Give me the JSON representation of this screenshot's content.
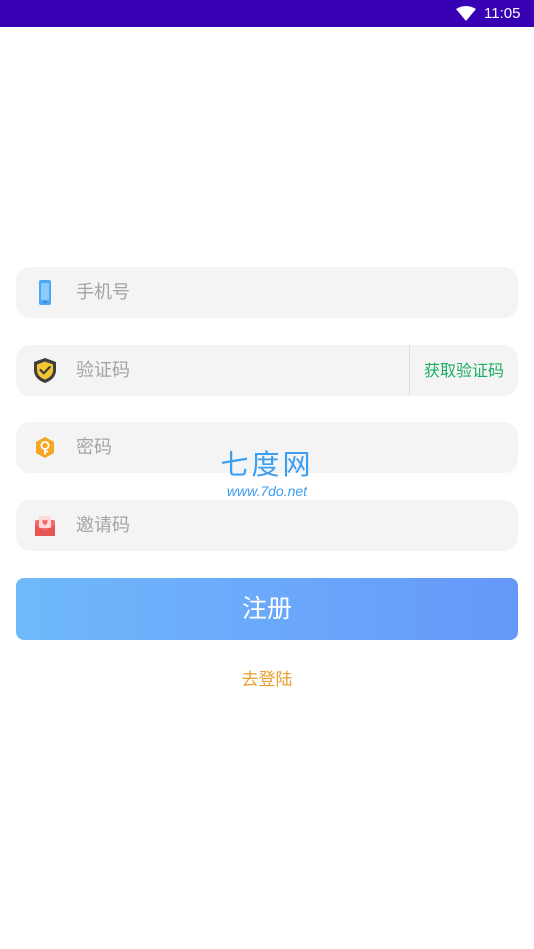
{
  "status_bar": {
    "time": "11:05",
    "wifi_icon": "wifi-icon",
    "color": "#3700b3"
  },
  "form": {
    "phone": {
      "placeholder": "手机号",
      "icon": "phone-icon"
    },
    "code": {
      "placeholder": "验证码",
      "icon": "shield-icon",
      "get_code_label": "获取验证码"
    },
    "password": {
      "placeholder": "密码",
      "icon": "key-badge-icon"
    },
    "invite": {
      "placeholder": "邀请码",
      "icon": "invite-mail-icon"
    }
  },
  "register_button": {
    "label": "注册",
    "gradient": [
      "#6fb9fb",
      "#6698fa"
    ]
  },
  "login_link": {
    "label": "去登陆",
    "color": "#e8a02c"
  },
  "watermark": {
    "title": "七度网",
    "url": "www.7do.net"
  },
  "colors": {
    "get_code": "#1aad63",
    "input_bg": "#f4f4f4",
    "placeholder": "#a3a3a3"
  }
}
